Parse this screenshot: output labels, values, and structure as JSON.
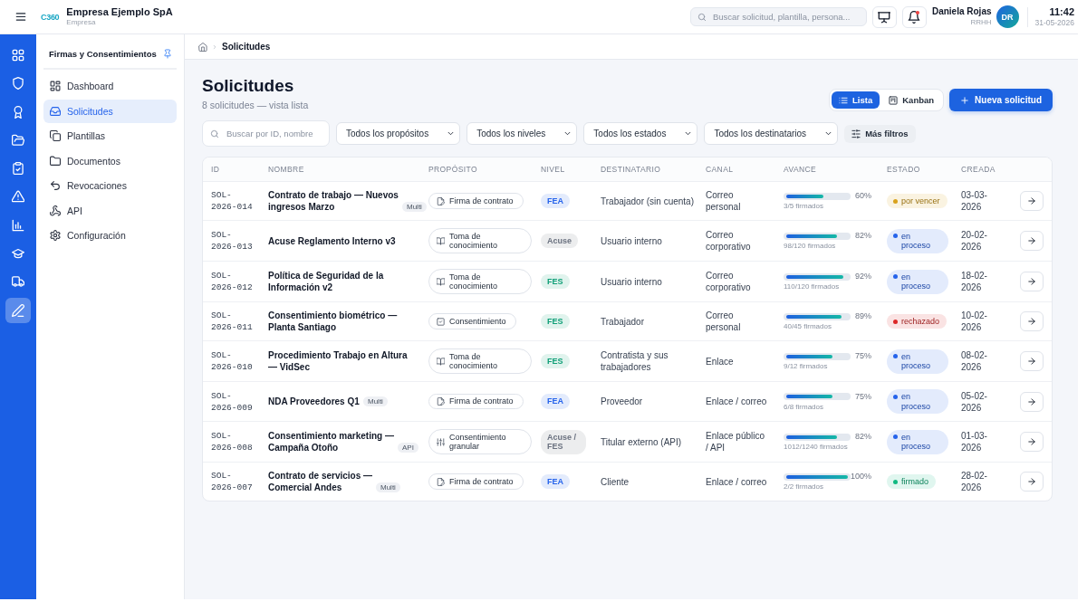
{
  "top_bar": {
    "logo": "C360",
    "company": "Empresa Ejemplo SpA",
    "company_type": "Empresa",
    "search": {
      "placeholder": "Buscar solicitud, plantilla, persona..."
    },
    "notifications": {
      "unread": true
    },
    "user": {
      "name": "Daniela Rojas",
      "role": "RRHH",
      "initials": "DR"
    },
    "clock": {
      "time": "11:42",
      "date": "31-05-2026"
    }
  },
  "rail": {
    "items": [
      {
        "selected": false
      },
      {
        "selected": false
      },
      {
        "selected": false
      },
      {
        "selected": false
      },
      {
        "selected": false
      },
      {
        "selected": false
      },
      {
        "selected": false
      },
      {
        "selected": false
      },
      {
        "selected": false
      },
      {
        "selected": true
      }
    ]
  },
  "sidebar": {
    "title": "Firmas y Consentimientos",
    "pinned": true,
    "items": [
      {
        "label": "Dashboard",
        "selected": false
      },
      {
        "label": "Solicitudes",
        "selected": true
      },
      {
        "label": "Plantillas",
        "selected": false
      },
      {
        "label": "Documentos",
        "selected": false
      },
      {
        "label": "Revocaciones",
        "selected": false
      },
      {
        "label": "API",
        "selected": false
      },
      {
        "label": "Configuración",
        "selected": false
      }
    ]
  },
  "breadcrumb": [
    "Solicitudes"
  ],
  "page": {
    "title": "Solicitudes",
    "subtitle": "8 solicitudes — vista lista",
    "views": [
      {
        "label": "Lista",
        "selected": true
      },
      {
        "label": "Kanban",
        "selected": false
      }
    ],
    "new_button": "Nueva solicitud"
  },
  "filters": {
    "search": {
      "placeholder": "Buscar por ID, nombre"
    },
    "dropdowns": [
      "Todos los propósitos",
      "Todos los niveles",
      "Todos los estados",
      "Todos los destinatarios"
    ],
    "more_button": "Más filtros"
  },
  "table": {
    "columns": [
      "ID",
      "NOMBRE",
      "PROPÓSITO",
      "NIVEL",
      "DESTINATARIO",
      "CANAL",
      "AVANCE",
      "ESTADO",
      "CREADA"
    ],
    "rows": [
      {
        "id": "SOL-2026-014",
        "name": "Contrato de trabajo — Nuevos ingresos Marzo",
        "tag": "Multi",
        "purpose": {
          "kind": "contract",
          "label": "Firma de contrato"
        },
        "level_tag": {
          "label": "FEA",
          "color": "#2563eb"
        },
        "recipient": "Trabajador (sin cuenta)",
        "channel": "Correo personal",
        "progress": {
          "level": 0.6,
          "percent": "60%",
          "detail": "3/5 firmados"
        },
        "status": {
          "label": "por vencer",
          "color": "#d9a21b"
        },
        "created": "03-03-2026"
      },
      {
        "id": "SOL-2026-013",
        "name": "Acuse Reglamento Interno v3",
        "purpose": {
          "kind": "acknowledgment",
          "label": "Toma de conocimiento"
        },
        "level_tag": {
          "label": "Acuse",
          "color": "#6b7280"
        },
        "recipient": "Usuario interno",
        "channel": "Correo corporativo",
        "progress": {
          "level": 0.82,
          "percent": "82%",
          "detail": "98/120 firmados"
        },
        "status": {
          "label": "en proceso",
          "color": "#2563eb"
        },
        "created": "20-02-2026"
      },
      {
        "id": "SOL-2026-012",
        "name": "Política de Seguridad de la Información v2",
        "purpose": {
          "kind": "acknowledgment",
          "label": "Toma de conocimiento"
        },
        "level_tag": {
          "label": "FES",
          "color": "#0f9f77"
        },
        "recipient": "Usuario interno",
        "channel": "Correo corporativo",
        "progress": {
          "level": 0.92,
          "percent": "92%",
          "detail": "110/120 firmados"
        },
        "status": {
          "label": "en proceso",
          "color": "#2563eb"
        },
        "created": "18-02-2026"
      },
      {
        "id": "SOL-2026-011",
        "name": "Consentimiento biométrico — Planta Santiago",
        "purpose": {
          "kind": "consent",
          "label": "Consentimiento"
        },
        "level_tag": {
          "label": "FES",
          "color": "#0f9f77"
        },
        "recipient": "Trabajador",
        "channel": "Correo personal",
        "progress": {
          "level": 0.89,
          "percent": "89%",
          "detail": "40/45 firmados"
        },
        "status": {
          "label": "rechazado",
          "color": "#dc2626"
        },
        "created": "10-02-2026"
      },
      {
        "id": "SOL-2026-010",
        "name": "Procedimiento Trabajo en Altura — VidSec",
        "purpose": {
          "kind": "acknowledgment",
          "label": "Toma de conocimiento"
        },
        "level_tag": {
          "label": "FES",
          "color": "#0f9f77"
        },
        "recipient": "Contratista y sus trabajadores",
        "channel": "Enlace",
        "progress": {
          "level": 0.75,
          "percent": "75%",
          "detail": "9/12 firmados"
        },
        "status": {
          "label": "en proceso",
          "color": "#2563eb"
        },
        "created": "08-02-2026"
      },
      {
        "id": "SOL-2026-009",
        "name": "NDA Proveedores Q1",
        "tag": "Multi",
        "purpose": {
          "kind": "contract",
          "label": "Firma de contrato"
        },
        "level_tag": {
          "label": "FEA",
          "color": "#2563eb"
        },
        "recipient": "Proveedor",
        "channel": "Enlace / correo",
        "progress": {
          "level": 0.75,
          "percent": "75%",
          "detail": "6/8 firmados"
        },
        "status": {
          "label": "en proceso",
          "color": "#2563eb"
        },
        "created": "05-02-2026"
      },
      {
        "id": "SOL-2026-008",
        "name": "Consentimiento marketing — Campaña Otoño",
        "tag": "API",
        "purpose": {
          "kind": "granular",
          "label": "Consentimiento granular"
        },
        "level_tag": {
          "label": "Acuse / FES",
          "color": "#6b7280"
        },
        "recipient": "Titular externo (API)",
        "channel": "Enlace público / API",
        "progress": {
          "level": 0.82,
          "percent": "82%",
          "detail": "1012/1240 firmados"
        },
        "status": {
          "label": "en proceso",
          "color": "#2563eb"
        },
        "created": "01-03-2026"
      },
      {
        "id": "SOL-2026-007",
        "name": "Contrato de servicios — Comercial Andes",
        "tag": "Multi",
        "purpose": {
          "kind": "contract",
          "label": "Firma de contrato"
        },
        "level_tag": {
          "label": "FEA",
          "color": "#2563eb"
        },
        "recipient": "Cliente",
        "channel": "Enlace / correo",
        "progress": {
          "level": 1,
          "percent": "100%",
          "detail": "2/2 firmados"
        },
        "status": {
          "label": "firmado",
          "color": "#10b981"
        },
        "created": "28-02-2026"
      }
    ]
  }
}
